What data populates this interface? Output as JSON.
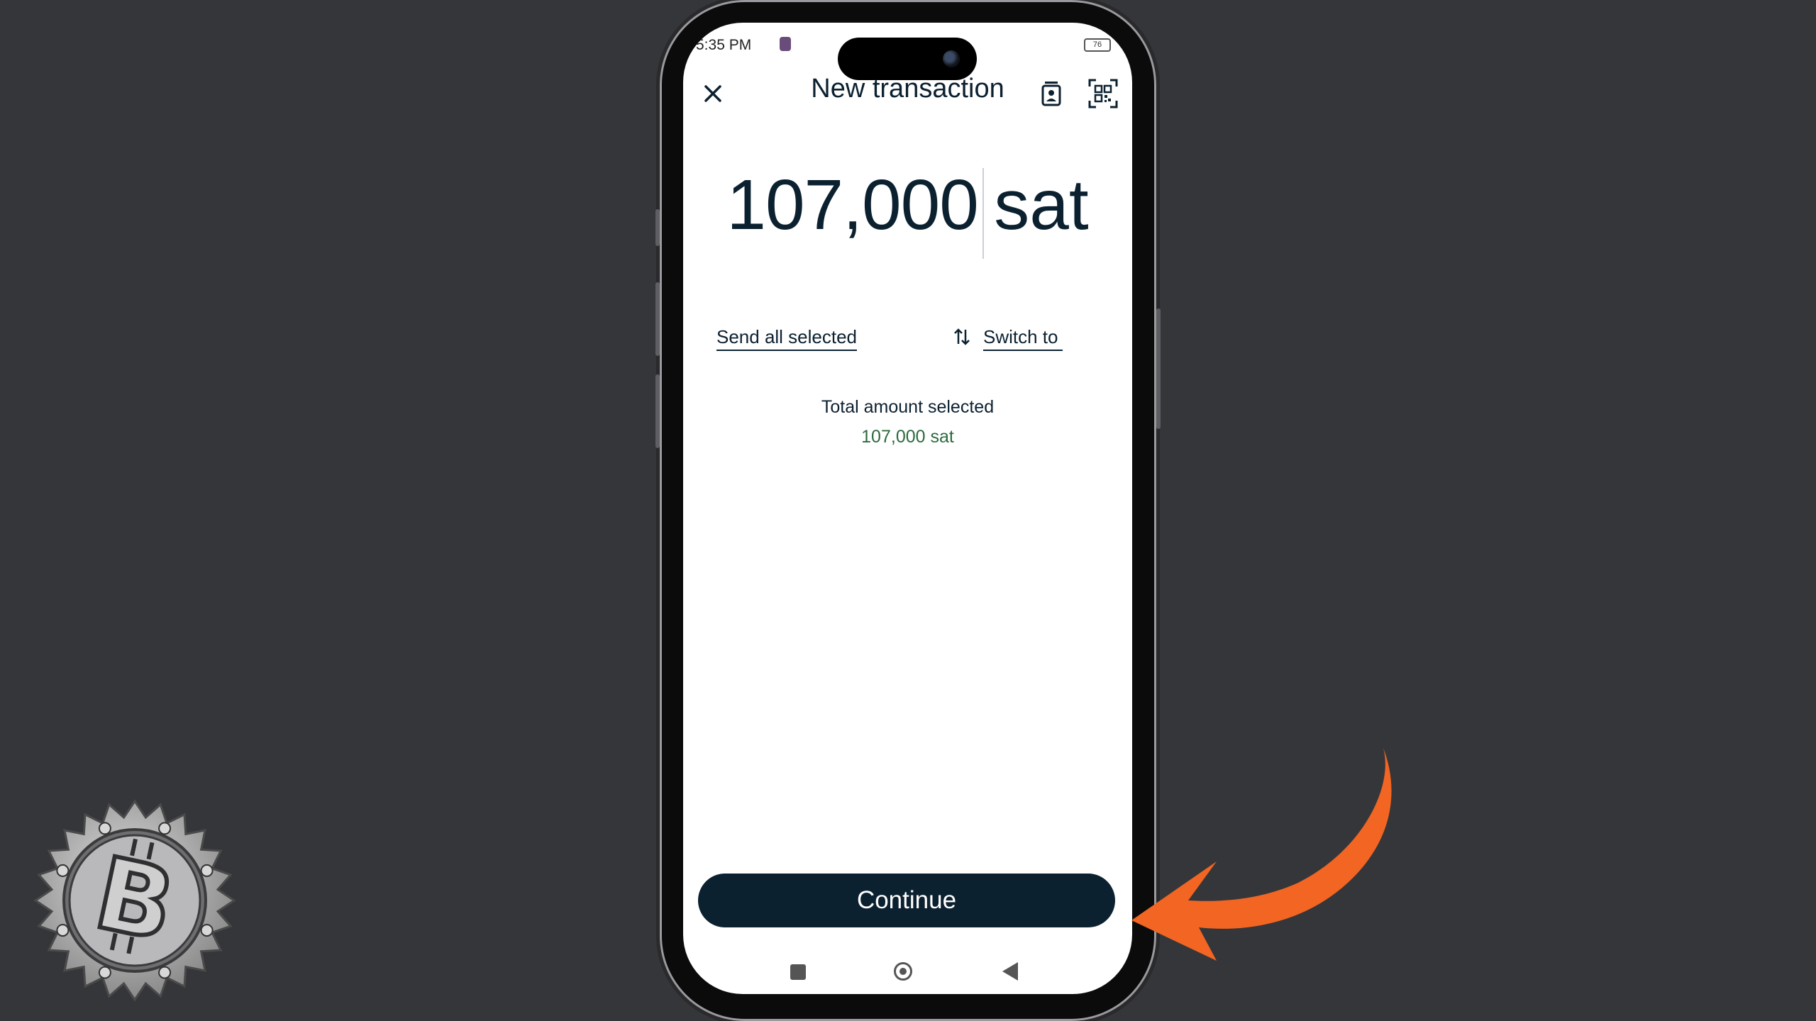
{
  "status_bar": {
    "time": "5:35 PM",
    "battery": "76"
  },
  "header": {
    "title": "New transaction",
    "close_icon": "close-icon",
    "contacts_icon": "contacts-icon",
    "qr_icon": "qr-scan-icon"
  },
  "amount": {
    "value": "107,000",
    "unit": "sat"
  },
  "actions": {
    "send_all": "Send all selected",
    "switch_to": "Switch to",
    "switch_icon": "swap-vertical-icon"
  },
  "summary": {
    "label": "Total amount selected",
    "value": "107,000 sat"
  },
  "footer": {
    "continue_label": "Continue"
  },
  "colors": {
    "primary": "#0c2130",
    "success": "#2d6a3e",
    "accent_arrow": "#f26522",
    "background": "#35363a"
  }
}
